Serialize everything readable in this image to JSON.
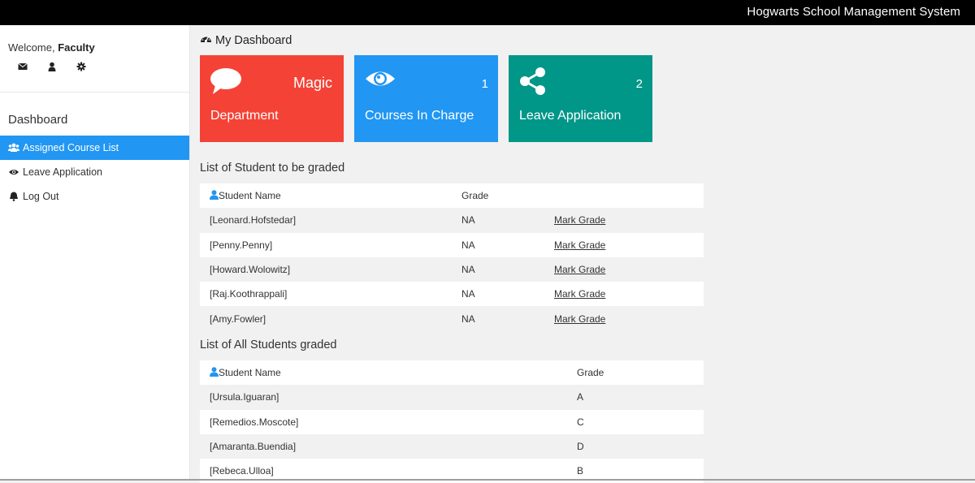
{
  "app": {
    "title": "Hogwarts School Management System"
  },
  "sidebar": {
    "welcome_prefix": "Welcome,",
    "user_name": "Faculty",
    "quick_icons": [
      "envelope-icon",
      "user-icon",
      "gear-icon"
    ],
    "section_title": "Dashboard",
    "items": [
      {
        "label": "Assigned Course List",
        "icon": "users-icon",
        "active": true
      },
      {
        "label": "Leave Application",
        "icon": "eye-icon",
        "active": false
      },
      {
        "label": "Log Out",
        "icon": "bell-icon",
        "active": false
      }
    ]
  },
  "main": {
    "page_title": "My Dashboard",
    "cards": [
      {
        "icon": "comment-icon",
        "value": "Magic",
        "label": "Department",
        "color": "#f44336"
      },
      {
        "icon": "eye-icon",
        "value": "1",
        "label": "Courses In Charge",
        "color": "#2196f3"
      },
      {
        "icon": "share-icon",
        "value": "2",
        "label": "Leave Application",
        "color": "#009688"
      }
    ],
    "to_grade": {
      "title": "List of Student to be graded",
      "headers": [
        "Student Name",
        "Grade"
      ],
      "rows": [
        {
          "name": "[Leonard.Hofstedar]",
          "grade": "NA",
          "action": "Mark Grade"
        },
        {
          "name": "[Penny.Penny]",
          "grade": "NA",
          "action": "Mark Grade"
        },
        {
          "name": "[Howard.Wolowitz]",
          "grade": "NA",
          "action": "Mark Grade"
        },
        {
          "name": "[Raj.Koothrappali]",
          "grade": "NA",
          "action": "Mark Grade"
        },
        {
          "name": "[Amy.Fowler]",
          "grade": "NA",
          "action": "Mark Grade"
        }
      ]
    },
    "graded": {
      "title": "List of All Students graded",
      "headers": [
        "Student Name",
        "Grade"
      ],
      "rows": [
        {
          "name": "[Ursula.Iguaran]",
          "grade": "A"
        },
        {
          "name": "[Remedios.Moscote]",
          "grade": "C"
        },
        {
          "name": "[Amaranta.Buendia]",
          "grade": "D"
        },
        {
          "name": "[Rebeca.Ulloa]",
          "grade": "B"
        }
      ]
    }
  },
  "colors": {
    "accent": "#2196f3",
    "danger": "#f44336",
    "teal": "#009688",
    "topbar": "#000000"
  }
}
